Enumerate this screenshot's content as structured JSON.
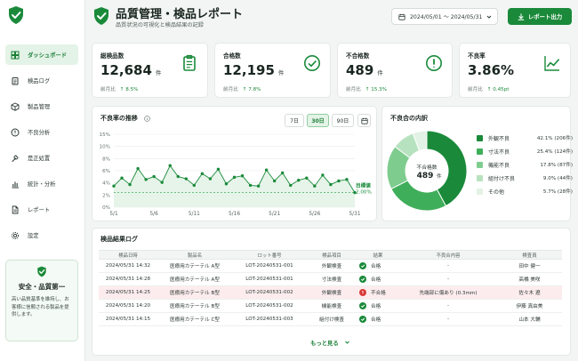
{
  "sidebar": {
    "items": [
      {
        "label": "ダッシュボード",
        "icon": "dashboard-icon",
        "active": true
      },
      {
        "label": "検品ログ",
        "icon": "clipboard-icon",
        "active": false
      },
      {
        "label": "製品管理",
        "icon": "box-icon",
        "active": false
      },
      {
        "label": "不良分析",
        "icon": "alert-icon",
        "active": false
      },
      {
        "label": "是正処置",
        "icon": "wrench-icon",
        "active": false
      },
      {
        "label": "統計・分析",
        "icon": "bar-chart-icon",
        "active": false
      },
      {
        "label": "レポート",
        "icon": "document-icon",
        "active": false
      },
      {
        "label": "設定",
        "icon": "gear-icon",
        "active": false
      }
    ],
    "safety": {
      "title": "安全・品質第一",
      "text": "高い品質基準を維持し、お客様に信頼される製品を提供します。"
    }
  },
  "header": {
    "title": "品質管理・検品レポート",
    "subtitle": "品質状況の可視化と検品結果の記録",
    "date_range": "2024/05/01 〜 2024/05/31",
    "report_button": "レポート出力"
  },
  "kpis": [
    {
      "label": "総検品数",
      "value": "12,684",
      "unit": "件",
      "compare": "前月比",
      "delta": "↑ 8.5%",
      "icon": "clipboard-check-icon"
    },
    {
      "label": "合格数",
      "value": "12,195",
      "unit": "件",
      "compare": "前月比",
      "delta": "↑ 7.8%",
      "icon": "check-circle-icon"
    },
    {
      "label": "不合格数",
      "value": "489",
      "unit": "件",
      "compare": "前月比",
      "delta": "↑ 15.3%",
      "icon": "exclamation-circle-icon"
    },
    {
      "label": "不良率",
      "value": "3.86%",
      "unit": "",
      "compare": "前月比",
      "delta": "↑ 0.45pt",
      "icon": "trend-line-icon"
    }
  ],
  "trend": {
    "title": "不良率の推移",
    "ranges": [
      "7日",
      "30日",
      "90日"
    ],
    "active_range": "30日",
    "target_label": "目標値",
    "target_value": "2.00%"
  },
  "chart_data": [
    {
      "type": "line",
      "title": "不良率の推移",
      "x": [
        "5/1",
        "5/2",
        "5/3",
        "5/4",
        "5/5",
        "5/6",
        "5/7",
        "5/8",
        "5/9",
        "5/10",
        "5/11",
        "5/12",
        "5/13",
        "5/14",
        "5/15",
        "5/16",
        "5/17",
        "5/18",
        "5/19",
        "5/20",
        "5/21",
        "5/22",
        "5/23",
        "5/24",
        "5/25",
        "5/26",
        "5/27",
        "5/28",
        "5/29",
        "5/30",
        "5/31"
      ],
      "x_tick_labels": [
        "5/1",
        "5/6",
        "5/11",
        "5/16",
        "5/21",
        "5/26",
        "5/31"
      ],
      "y_tick_labels": [
        "0%",
        "2%",
        "4%",
        "6%",
        "8%",
        "10%",
        "15%"
      ],
      "series": [
        {
          "values": [
            2.9,
            4.0,
            3.1,
            5.3,
            3.8,
            4.2,
            3.4,
            5.7,
            4.2,
            3.9,
            3.0,
            4.6,
            3.9,
            5.2,
            3.2,
            4.1,
            4.3,
            3.0,
            2.9,
            5.1,
            3.6,
            4.7,
            3.0,
            3.7,
            4.0,
            2.9,
            4.4,
            3.1,
            3.6,
            3.8,
            2.0
          ]
        }
      ],
      "target": 2.0,
      "ylim": [
        0,
        10
      ],
      "grid": true
    },
    {
      "type": "pie",
      "title": "不良合の内訳",
      "center_label": "不合格数",
      "center_value": "489",
      "center_unit": "件",
      "categories": [
        "外観不良",
        "寸法不良",
        "機能不良",
        "組付け不良",
        "その他"
      ],
      "values": [
        42.1,
        25.4,
        17.8,
        9.0,
        5.7
      ],
      "value_labels": [
        "42.1% (206件)",
        "25.4% (124件)",
        "17.8% (87件)",
        "9.0% (44件)",
        "5.7% (28件)"
      ],
      "colors": [
        "#1a8a3a",
        "#3fae5a",
        "#7fcc8f",
        "#b7e2bf",
        "#e2f2e5"
      ]
    }
  ],
  "table": {
    "title": "検品結果ログ",
    "headers": [
      "検品日時",
      "製品名",
      "ロット番号",
      "検品項目",
      "結果",
      "不良合内容",
      "検査員"
    ],
    "rows": [
      {
        "datetime": "2024/05/31 14:32",
        "product": "医療用カテーテル A型",
        "lot": "LOT-20240531-001",
        "item": "外観検査",
        "result": "合格",
        "status": "pass",
        "defect": "-",
        "inspector": "田中 健一"
      },
      {
        "datetime": "2024/05/31 14:28",
        "product": "医療用カテーテル A型",
        "lot": "LOT-20240531-001",
        "item": "寸法検査",
        "result": "合格",
        "status": "pass",
        "defect": "-",
        "inspector": "高橋 美咲"
      },
      {
        "datetime": "2024/05/31 14:25",
        "product": "医療用カテーテル B型",
        "lot": "LOT-20240531-002",
        "item": "外観検査",
        "result": "不合格",
        "status": "fail",
        "defect": "先端部に傷あり (0.3mm)",
        "inspector": "佐々木 遼"
      },
      {
        "datetime": "2024/05/31 14:20",
        "product": "医療用カテーテル B型",
        "lot": "LOT-20240531-002",
        "item": "機能検査",
        "result": "合格",
        "status": "pass",
        "defect": "-",
        "inspector": "伊藤 真由美"
      },
      {
        "datetime": "2024/05/31 14:15",
        "product": "医療用カテーテル C型",
        "lot": "LOT-20240531-003",
        "item": "組付け検査",
        "result": "合格",
        "status": "pass",
        "defect": "-",
        "inspector": "山本 大輔"
      }
    ],
    "more_label": "もっと見る"
  },
  "colors": {
    "accent": "#1a8a3a",
    "accent_light": "#e4f3e7",
    "error": "#d93a3a",
    "error_row": "#fdecee"
  }
}
